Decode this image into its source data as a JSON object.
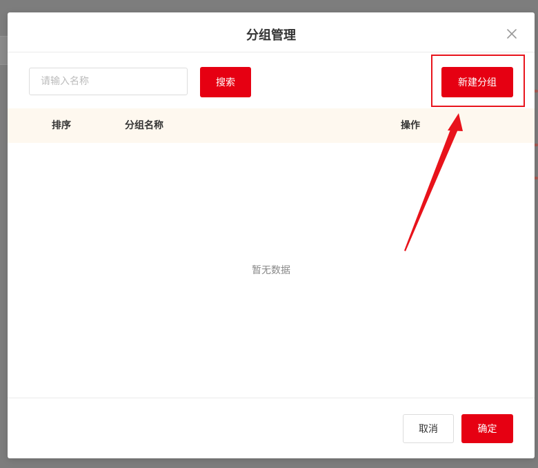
{
  "dialog": {
    "title": "分组管理"
  },
  "toolbar": {
    "search_placeholder": "请输入名称",
    "search_value": "",
    "search_label": "搜索",
    "new_group_label": "新建分组"
  },
  "table": {
    "columns": [
      "排序",
      "分组名称",
      "操作"
    ],
    "rows": [],
    "empty_text": "暂无数据"
  },
  "footer": {
    "cancel_label": "取消",
    "confirm_label": "确定"
  },
  "colors": {
    "accent": "#e60012",
    "annotation": "#e8131b",
    "header_bg": "#fef8ef",
    "overlay": "#7d7d7d"
  },
  "icons": {
    "close": "close-icon"
  }
}
